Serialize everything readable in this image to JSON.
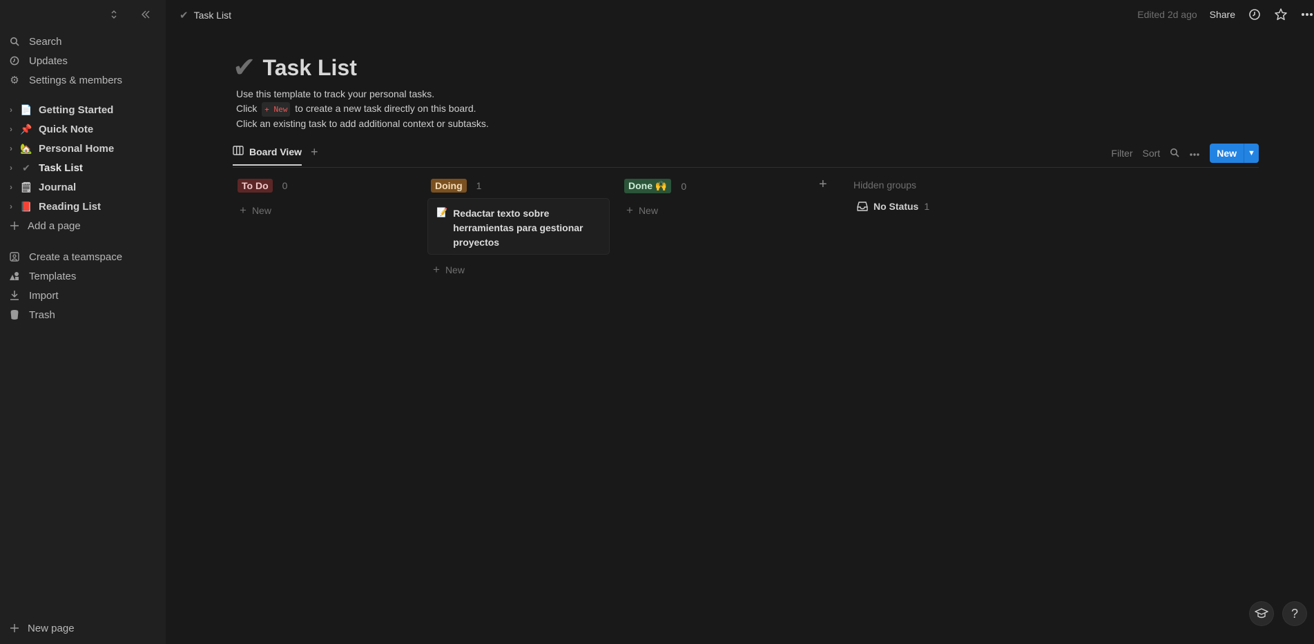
{
  "breadcrumb": {
    "title": "Task List"
  },
  "topbar": {
    "edited": "Edited 2d ago",
    "share": "Share"
  },
  "sidebar": {
    "system": [
      {
        "label": "Search",
        "icon": "search-icon"
      },
      {
        "label": "Updates",
        "icon": "clock-icon"
      },
      {
        "label": "Settings & members",
        "icon": "gear-icon"
      }
    ],
    "pages": [
      {
        "label": "Getting Started",
        "emoji": "📄"
      },
      {
        "label": "Quick Note",
        "emoji": "📌"
      },
      {
        "label": "Personal Home",
        "emoji": "🏡"
      },
      {
        "label": "Task List",
        "emoji": "✔"
      },
      {
        "label": "Journal",
        "emoji": "🗒"
      },
      {
        "label": "Reading List",
        "emoji": "📕"
      }
    ],
    "add_page": "Add a page",
    "extras": [
      {
        "label": "Create a teamspace",
        "icon": "teamspace-icon"
      },
      {
        "label": "Templates",
        "icon": "templates-icon"
      },
      {
        "label": "Import",
        "icon": "import-icon"
      },
      {
        "label": "Trash",
        "icon": "trash-icon"
      }
    ],
    "new_page": "New page"
  },
  "page": {
    "icon": "✔",
    "title": "Task List",
    "desc_line1": "Use this template to track your personal tasks.",
    "desc_line2_pre": "Click",
    "desc_line2_pill": "+ New",
    "desc_line2_post": "to create a new task directly on this board.",
    "desc_line3": "Click an existing task to add additional context or subtasks."
  },
  "view": {
    "tab": "Board View",
    "filter": "Filter",
    "sort": "Sort",
    "new": "New"
  },
  "board": {
    "columns": [
      {
        "label": "To Do",
        "count": "0",
        "new": "New"
      },
      {
        "label": "Doing",
        "count": "1",
        "new": "New"
      },
      {
        "label": "Done 🙌",
        "count": "0",
        "new": "New"
      }
    ],
    "card": {
      "title": "Redactar texto sobre herramientas para gestionar proyectos"
    },
    "hidden_groups": "Hidden groups",
    "no_status": {
      "label": "No Status",
      "count": "1"
    }
  },
  "bottom": {
    "help": "?"
  },
  "colors": {
    "accent": "#2383e2",
    "background": "#191919",
    "sidebar": "#202020"
  }
}
